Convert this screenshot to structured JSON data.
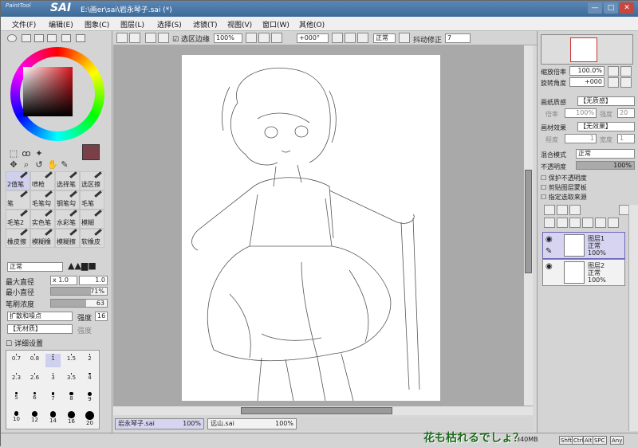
{
  "titlebar": {
    "logo_small": "PaintTool",
    "logo_big": "SAI",
    "title": "E:\\画er\\sai\\岩永琴子.sai (*)"
  },
  "window_buttons": {
    "minimize": "—",
    "maximize": "□",
    "close": "✕"
  },
  "menu": [
    "文件(F)",
    "编辑(E)",
    "图象(C)",
    "图层(L)",
    "选择(S)",
    "滤镜(T)",
    "视图(V)",
    "窗口(W)",
    "其他(O)"
  ],
  "toolbar": {
    "selection_edge_label": "选区边缘",
    "zoom": "100%",
    "angle": "+000°",
    "blend": "正常",
    "stabilizer_label": "抖动修正",
    "stabilizer": "7"
  },
  "left": {
    "brushes": [
      "2值笔",
      "喷枪",
      "选择笔",
      "选区擦",
      "笔",
      "毛笔勾",
      "钢笔勾",
      "毛笔",
      "毛笔2",
      "实色笔",
      "水彩笔",
      "模糊",
      "橡皮擦",
      "模糊橡",
      "模糊擦",
      "软橡皮"
    ],
    "blend": "正常",
    "max_size_label": "最大直径",
    "max_size_mult": "x 1.0",
    "max_size": "1.0",
    "min_size_label": "最小直径",
    "min_size": "71%",
    "density_label": "笔刷浓度",
    "density": "63",
    "spread_label": "扩散和噪点",
    "strength_label": "强度",
    "strength": "16",
    "texture_label": "【无材质】",
    "texture_strength_label": "强度",
    "detail_label": "详细设置",
    "dot_sizes": [
      "0.7",
      "0.8",
      "1",
      "1.5",
      "2",
      "2.3",
      "2.6",
      "3",
      "3.5",
      "4",
      "5",
      "6",
      "7",
      "8",
      "9",
      "10",
      "12",
      "14",
      "16",
      "20"
    ]
  },
  "right": {
    "zoom_label": "缩放倍率",
    "zoom": "100.0%",
    "rotate_label": "旋转角度",
    "rotate": "+000",
    "paper_label": "画纸质感",
    "paper": "【无质感】",
    "scale_label": "倍率",
    "scale": "100%",
    "strength_label": "强度",
    "strength": "20",
    "effect_label": "画材效果",
    "effect": "【无效果】",
    "degree_label": "程度",
    "degree": "1",
    "width_label": "宽度",
    "width": "1",
    "blend_label": "混合模式",
    "blend": "正常",
    "opacity_label": "不透明度",
    "opacity": "100%",
    "protect_alpha": "保护不透明度",
    "clipping": "剪贴图层蒙板",
    "selection_source": "指定选取来源",
    "layers": [
      {
        "name": "图层1",
        "mode": "正常",
        "opacity": "100%"
      },
      {
        "name": "图层2",
        "mode": "正常",
        "opacity": "100%"
      }
    ]
  },
  "doc_tabs": [
    {
      "name": "岩永琴子.sai",
      "zoom": "100%"
    },
    {
      "name": "远山.sai",
      "zoom": "100%"
    }
  ],
  "status": {
    "memory": "340MB",
    "keys": [
      "Shft",
      "Ctrl",
      "Alt",
      "SPC",
      "Any"
    ],
    "watermark": "花も枯れるでしょ？"
  },
  "colors": {
    "current": "#7a4048",
    "accent": "#3e6a98",
    "selection": "#d6d4f0"
  }
}
